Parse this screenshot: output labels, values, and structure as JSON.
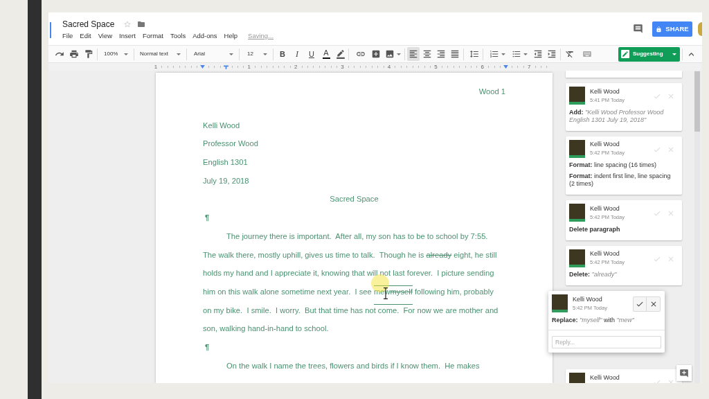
{
  "window": {
    "title": "Sacred Space",
    "menu": [
      "File",
      "Edit",
      "View",
      "Insert",
      "Format",
      "Tools",
      "Add-ons",
      "Help"
    ],
    "status": "Saving...",
    "share_button": "SHARE"
  },
  "toolbar": {
    "zoom": "100%",
    "style": "Normal text",
    "font": "Arial",
    "size": "12",
    "format_buttons": [
      {
        "kind": "bold",
        "label": "B"
      },
      {
        "kind": "italic",
        "label": "I"
      },
      {
        "kind": "underline",
        "label": "U"
      },
      {
        "kind": "color",
        "label": "A"
      }
    ],
    "alignment": [
      {
        "selected": true
      },
      {
        "selected": false
      },
      {
        "selected": false
      },
      {
        "selected": false
      }
    ],
    "mode_button": "Suggesting"
  },
  "ruler": [
    "1",
    "1",
    "2",
    "3",
    "4",
    "5",
    "6",
    "7"
  ],
  "document": {
    "header": "Wood 1",
    "blocks": [
      {
        "kind": "line",
        "text": "Kelli Wood"
      },
      {
        "kind": "line",
        "text": "Professor Wood"
      },
      {
        "kind": "line",
        "text": "English 1301"
      },
      {
        "kind": "line",
        "text": "July 19, 2018"
      },
      {
        "kind": "centered",
        "text": "Sacred Space"
      },
      {
        "kind": "pilcrow",
        "text": "¶"
      },
      {
        "kind": "paragraph",
        "segments": [
          {
            "kind": "text",
            "text": "The journey there is important.  After all, my son has to be to school by 7:55.  The walk there, mostly uphill, gives us time to talk.  Though he is "
          },
          {
            "kind": "deleted",
            "text": "already"
          },
          {
            "kind": "text",
            "text": " eight, he still holds my hand and I appreciate it, knowing that will not last forever.  I picture sending him on this walk alone sometime next year.  I see "
          },
          {
            "kind": "focus",
            "segments": [
              {
                "kind": "text",
                "text": "mew"
              },
              {
                "kind": "deleted",
                "text": "myself"
              }
            ]
          },
          {
            "kind": "text",
            "text": " following him, probably on my bike.  I smile.  I worry.  But that time has not come.  For now we are mother and son, walking hand-in-hand to school."
          }
        ]
      },
      {
        "kind": "pilcrow",
        "text": "¶"
      },
      {
        "kind": "paragraph",
        "segments": [
          {
            "kind": "text",
            "text": "On the walk I name the trees, flowers and birds if I know them.  He makes"
          }
        ]
      }
    ]
  },
  "comments": [
    {
      "author": "Kelli Wood",
      "time": "5:41 PM Today",
      "active": false,
      "lines": [
        {
          "text": "**Add:** *\"Kelli Wood Professor Wood English 1301 July 19, 2018\"*",
          "bold": false
        }
      ]
    },
    {
      "author": "Kelli Wood",
      "time": "5:42 PM Today",
      "active": false,
      "lines": [
        {
          "text": "**Format:** line spacing (16 times)",
          "bold": false
        },
        {
          "text": "**Format:** indent first line, line spacing (2 times)",
          "bold": false
        }
      ]
    },
    {
      "author": "Kelli Wood",
      "time": "5:42 PM Today",
      "active": false,
      "lines": [
        {
          "text": "Delete paragraph",
          "bold": true
        }
      ]
    },
    {
      "author": "Kelli Wood",
      "time": "5:42 PM Today",
      "active": false,
      "lines": [
        {
          "text": "**Delete:** *\"already\"*",
          "bold": false
        }
      ]
    },
    {
      "author": "Kelli Wood",
      "time": "5:42 PM Today",
      "active": true,
      "lines": [
        {
          "text": "**Replace:** *\"myself\"* with *\"mew\"*",
          "bold": false
        }
      ],
      "reply_placeholder": "Reply..."
    },
    {
      "author": "Kelli Wood",
      "active": false
    }
  ]
}
